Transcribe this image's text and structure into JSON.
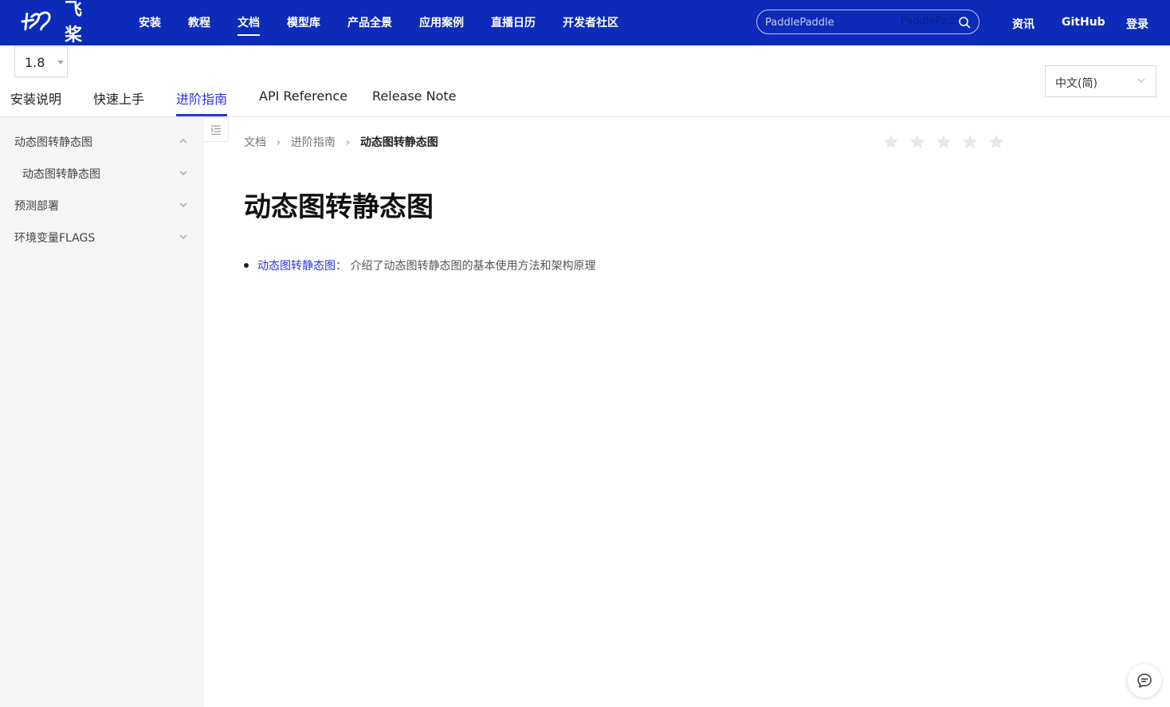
{
  "brand": {
    "logo_text": "飞桨",
    "logo_icon": "paddlepaddle-logo-icon"
  },
  "topnav": {
    "items": [
      {
        "label": "安装",
        "active": false
      },
      {
        "label": "教程",
        "active": false
      },
      {
        "label": "文档",
        "active": true
      },
      {
        "label": "模型库",
        "active": false
      },
      {
        "label": "产品全景",
        "active": false
      },
      {
        "label": "应用案例",
        "active": false
      },
      {
        "label": "直播日历",
        "active": false
      },
      {
        "label": "开发者社区",
        "active": false
      }
    ],
    "search": {
      "placeholder": "PaddlePaddle",
      "ghost_text": "PaddlePaddle",
      "icon": "search-icon"
    },
    "right_links": [
      {
        "label": "资讯"
      },
      {
        "label": "GitHub"
      },
      {
        "label": "登录"
      }
    ]
  },
  "version_select": {
    "value": "1.8"
  },
  "subtabs": [
    {
      "label": "安装说明",
      "active": false
    },
    {
      "label": "快速上手",
      "active": false
    },
    {
      "label": "进阶指南",
      "active": true
    },
    {
      "label": "API Reference",
      "active": false
    },
    {
      "label": "Release Note",
      "active": false
    }
  ],
  "language_select": {
    "value": "中文(简)"
  },
  "sidebar": {
    "items": [
      {
        "label": "动态图转静态图",
        "expanded": true,
        "level": 0
      },
      {
        "label": "动态图转静态图",
        "expanded": false,
        "level": 1
      },
      {
        "label": "预测部署",
        "expanded": false,
        "level": 0
      },
      {
        "label": "环境变量FLAGS",
        "expanded": false,
        "level": 0
      }
    ]
  },
  "breadcrumb": {
    "items": [
      "文档",
      "进阶指南",
      "动态图转静态图"
    ],
    "separator": ">"
  },
  "rating": {
    "max": 5,
    "value": 0,
    "empty_color": "#e8e8e8"
  },
  "page": {
    "title": "动态图转静态图",
    "list": [
      {
        "link": "动态图转静态图",
        "separator": "：",
        "desc": "介绍了动态图转静态图的基本使用方法和架构原理"
      }
    ]
  },
  "colors": {
    "nav_bg": "#0c2bb8",
    "accent": "#2932e1",
    "sidebar_bg": "#f5f5f5"
  },
  "feedback": {
    "icon": "chat-feedback-icon"
  }
}
